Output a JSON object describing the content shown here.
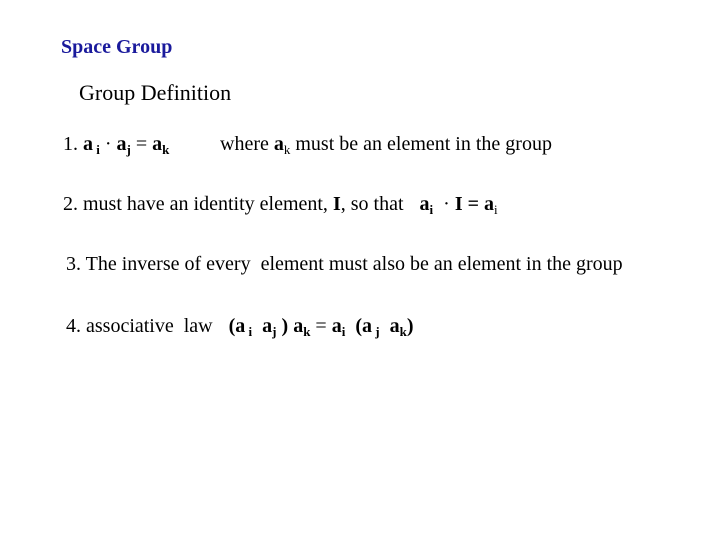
{
  "slide": {
    "title": "Space Group",
    "subtitle": "Group Definition",
    "items": [
      {
        "number": "1.",
        "formula": {
          "a": "a",
          "i": "i",
          "dot": "·",
          "j": "j",
          "eq": "=",
          "k": "k"
        },
        "text_where": "where",
        "text_rest": "must be an element in the group"
      },
      {
        "number": "2.",
        "text": "must have an identity element,",
        "identity": "I",
        "text_sothat": ", so that",
        "formula": {
          "a": "a",
          "i": "i",
          "dot": "·",
          "I": "I",
          "eq": "="
        }
      },
      {
        "number": "3.",
        "text": "The inverse of every  element must also be an element in the group"
      },
      {
        "number": "4.",
        "text": "associative  law",
        "formula": {
          "open": "(",
          "close": ")",
          "a": "a",
          "i": "i",
          "j": "j",
          "k": "k",
          "eq": "="
        }
      }
    ]
  }
}
